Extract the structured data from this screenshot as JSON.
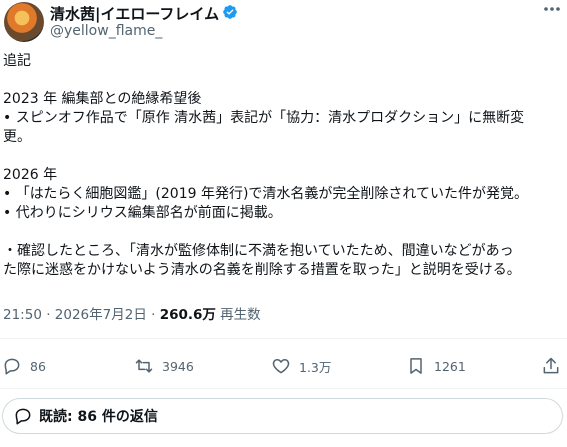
{
  "user": {
    "display_name": "清水茜|イエローフレイム",
    "handle": "@yellow_flame_"
  },
  "post": {
    "lines": [
      "追記",
      "",
      "2023 年 編集部との絶縁希望後",
      "• スピンオフ作品で「原作 清水茜」表記が「協力：清水プロダクション」に無断変",
      "更。",
      "",
      "2026 年",
      "• 「はたらく細胞図鑑」(2019 年発行)で清水名義が完全削除されていた件が発覚。",
      "• 代わりにシリウス編集部名が前面に掲載。",
      "",
      "・確認したところ、「清水が監修体制に不満を抱いていたため、間違いなどがあっ",
      "た際に迷惑をかけないよう清水の名義を削除する措置を取った」と説明を受ける。"
    ],
    "time": "21:50 · 2026年7月2日 · ",
    "views_count": "260.6万",
    "views_label": " 再生数"
  },
  "actions": {
    "replies": "86",
    "reposts": "3946",
    "likes": "1.3万",
    "bookmarks": "1261"
  },
  "read_replies": "既読: 86 件の返信",
  "colors": {
    "verified": "#1d9bf0",
    "secondary_text": "#536471",
    "primary_text": "#0f1419"
  }
}
